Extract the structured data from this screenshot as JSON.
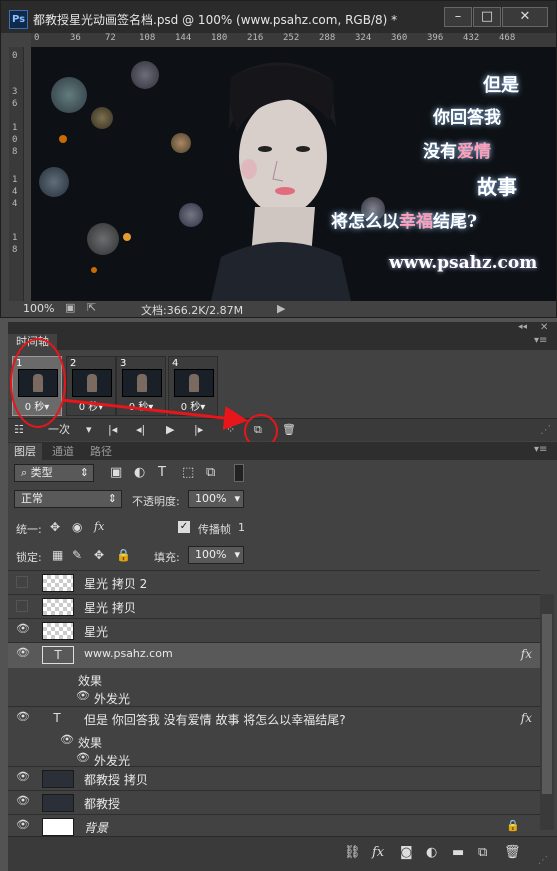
{
  "document": {
    "title": "都教授星光动画签名档.psd @ 100% (www.psahz.com, RGB/8) *",
    "ruler_h": [
      "0",
      "36",
      "72",
      "108",
      "144",
      "180",
      "216",
      "252",
      "288",
      "324",
      "360",
      "396",
      "432",
      "468"
    ],
    "ruler_v": [
      "0",
      "3",
      "6",
      "1",
      "0",
      "8",
      "1",
      "4",
      "4",
      "1",
      "8"
    ],
    "zoom": "100%",
    "doc_info": "文档:366.2K/2.87M",
    "poem": [
      "但是",
      "你回答我",
      "没有",
      "爱情",
      "故事",
      "将怎么以",
      "幸福",
      "结尾?"
    ],
    "watermark": "www.psahz.com"
  },
  "timeline": {
    "tab": "时间轴",
    "frames": [
      {
        "num": "1",
        "dur": "0 秒▾"
      },
      {
        "num": "2",
        "dur": "0 秒▾"
      },
      {
        "num": "3",
        "dur": "0 秒▾"
      },
      {
        "num": "4",
        "dur": "0 秒▾"
      }
    ],
    "loop": "一次"
  },
  "layers_panel": {
    "tabs": [
      "图层",
      "通道",
      "路径"
    ],
    "filter_kind": "类型",
    "blend_mode": "正常",
    "opacity_label": "不透明度:",
    "opacity_value": "100%",
    "unify_label": "统一:",
    "propagate_label": "传播帧",
    "propagate_value": "1",
    "lock_label": "锁定:",
    "fill_label": "填充:",
    "fill_value": "100%",
    "layers": [
      {
        "name": "星光 拷贝 2",
        "visible": false
      },
      {
        "name": "星光 拷贝",
        "visible": false
      },
      {
        "name": "星光",
        "visible": true
      },
      {
        "name": "www.psahz.com",
        "visible": true,
        "type": "text"
      },
      {
        "name": "效果"
      },
      {
        "name": "外发光"
      },
      {
        "name": "但是 你回答我 没有爱情 故事 将怎么以幸福结尾?",
        "visible": true,
        "type": "text"
      },
      {
        "name": "效果"
      },
      {
        "name": "外发光"
      },
      {
        "name": "都教授 拷贝",
        "visible": true
      },
      {
        "name": "都教授",
        "visible": true
      },
      {
        "name": "背景",
        "visible": true
      }
    ]
  }
}
